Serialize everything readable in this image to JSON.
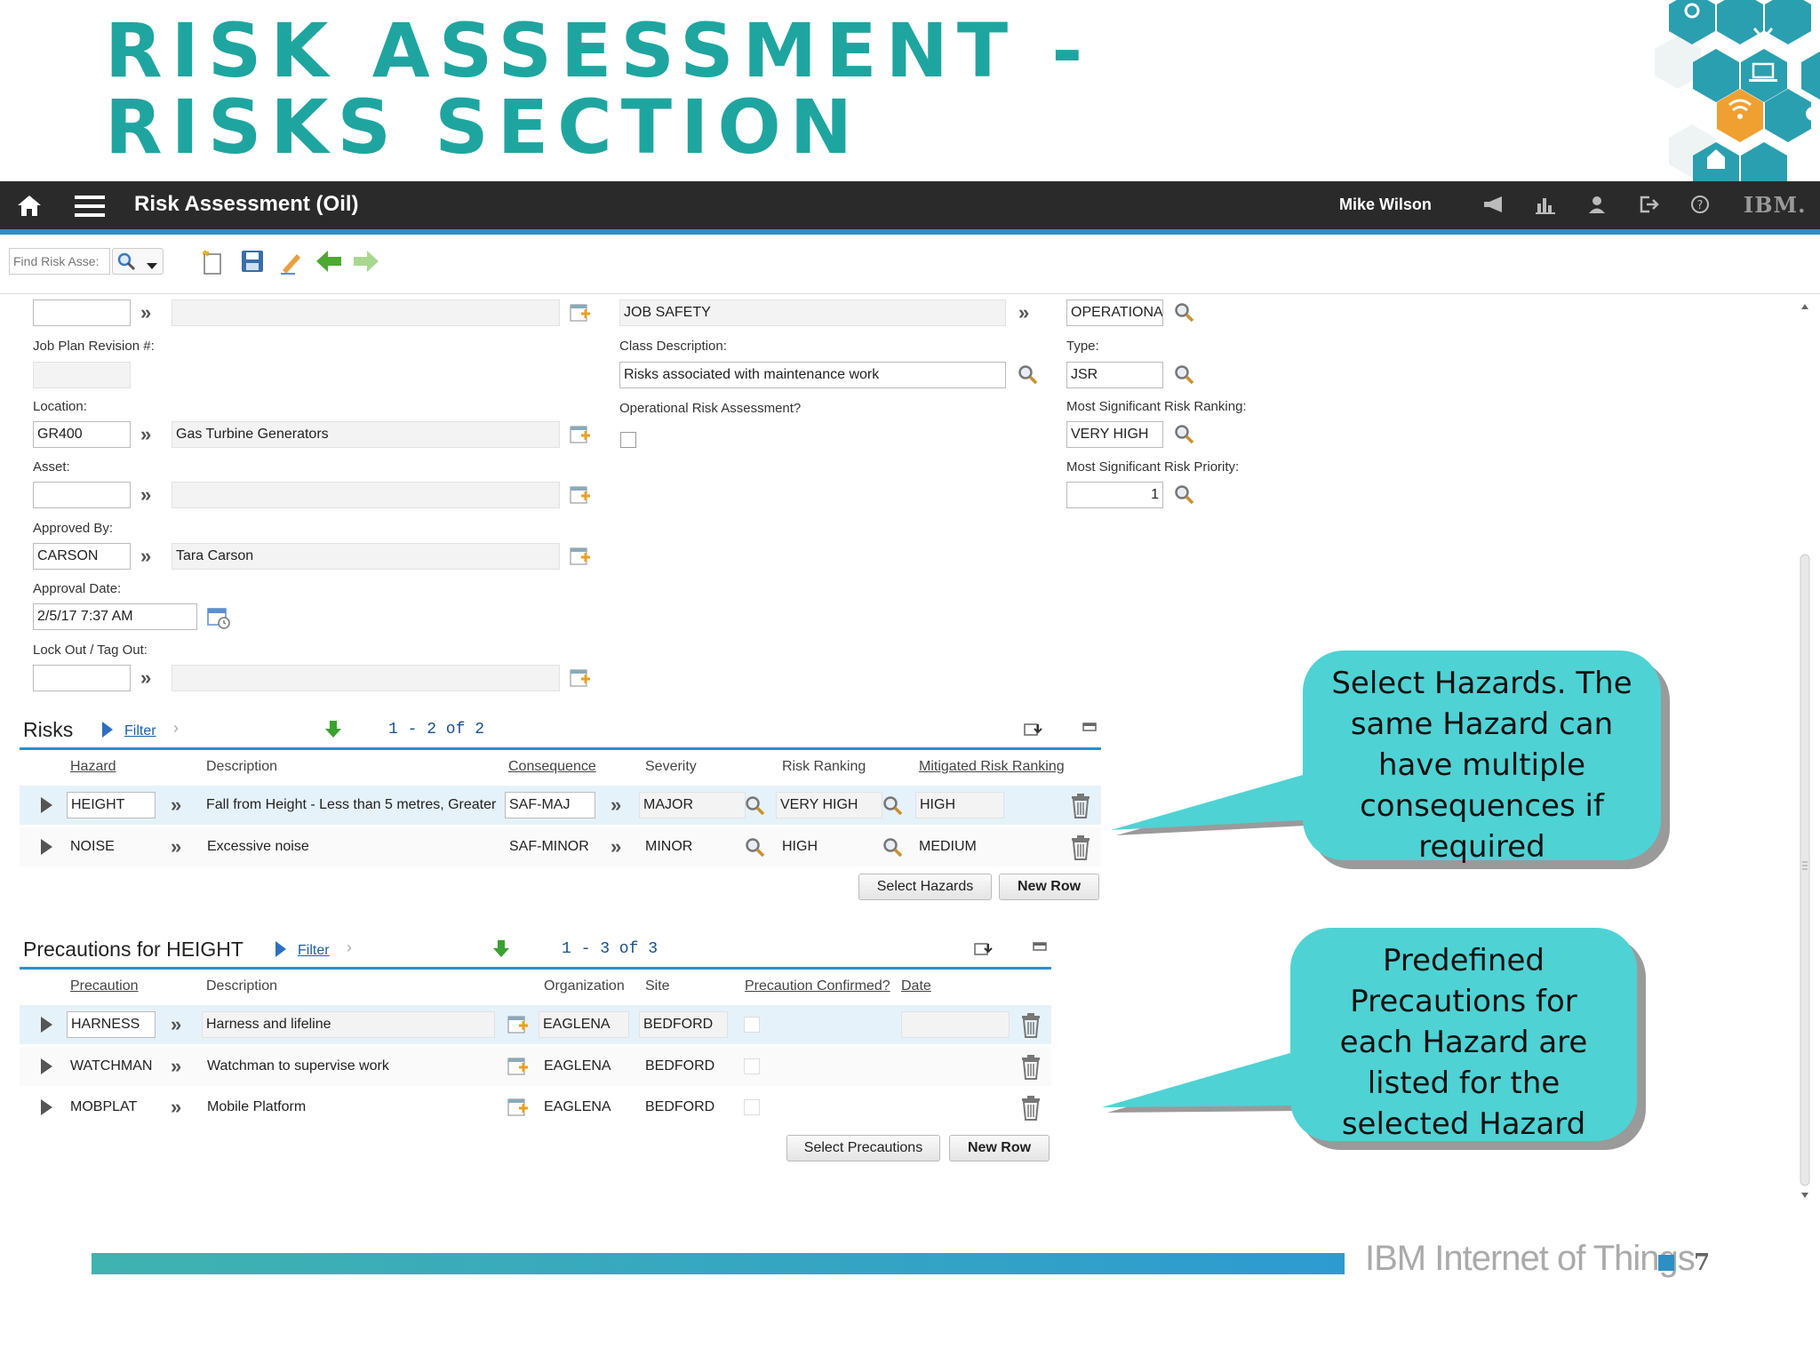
{
  "slide": {
    "title_line1": "Risk assessment -",
    "title_line2": "Risks section",
    "footer_brand": "IBM Internet of Things",
    "page_number": "7"
  },
  "appbar": {
    "title": "Risk Assessment (Oil)",
    "user": "Mike Wilson",
    "ibm": "IBM."
  },
  "toolbar": {
    "find_placeholder": "Find Risk Asse:"
  },
  "form": {
    "class_value": "JOB SAFETY",
    "category_value": "OPERATIONAL",
    "job_plan_revision_label": "Job Plan Revision #:",
    "class_description_label": "Class Description:",
    "class_description_value": "Risks associated with maintenance work",
    "type_label": "Type:",
    "type_value": "JSR",
    "location_label": "Location:",
    "location_value": "GR400",
    "location_desc": "Gas Turbine Generators",
    "operational_label": "Operational Risk Assessment?",
    "ranking_label": "Most Significant Risk Ranking:",
    "ranking_value": "VERY HIGH",
    "asset_label": "Asset:",
    "priority_label": "Most Significant Risk Priority:",
    "priority_value": "1",
    "approved_by_label": "Approved By:",
    "approved_by_value": "CARSON",
    "approved_by_name": "Tara Carson",
    "approval_date_label": "Approval Date:",
    "approval_date_value": "2/5/17 7:37 AM",
    "lockout_label": "Lock Out / Tag Out:"
  },
  "risks": {
    "title": "Risks",
    "filter": "Filter",
    "pager": "1 - 2 of 2",
    "headers": {
      "hazard": "Hazard",
      "description": "Description",
      "consequence": "Consequence",
      "severity": "Severity",
      "risk_ranking": "Risk Ranking",
      "mitigated": "Mitigated Risk Ranking"
    },
    "rows": [
      {
        "hazard": "HEIGHT",
        "description": "Fall from Height - Less than 5 metres, Greater",
        "consequence": "SAF-MAJ",
        "severity": "MAJOR",
        "ranking": "VERY HIGH",
        "mitigated": "HIGH"
      },
      {
        "hazard": "NOISE",
        "description": "Excessive noise",
        "consequence": "SAF-MINOR",
        "severity": "MINOR",
        "ranking": "HIGH",
        "mitigated": "MEDIUM"
      }
    ],
    "select_button": "Select Hazards",
    "new_row_button": "New Row"
  },
  "precautions": {
    "title": "Precautions for HEIGHT",
    "filter": "Filter",
    "pager": "1 - 3 of 3",
    "headers": {
      "precaution": "Precaution",
      "description": "Description",
      "organization": "Organization",
      "site": "Site",
      "confirmed": "Precaution Confirmed?",
      "date": "Date"
    },
    "rows": [
      {
        "precaution": "HARNESS",
        "description": "Harness and lifeline",
        "organization": "EAGLENA",
        "site": "BEDFORD"
      },
      {
        "precaution": "WATCHMAN",
        "description": "Watchman to supervise work",
        "organization": "EAGLENA",
        "site": "BEDFORD"
      },
      {
        "precaution": "MOBPLAT",
        "description": "Mobile Platform",
        "organization": "EAGLENA",
        "site": "BEDFORD"
      }
    ],
    "select_button": "Select Precautions",
    "new_row_button": "New Row"
  },
  "callouts": {
    "hazards": [
      "Select Hazards. The",
      "same Hazard can",
      "have multiple",
      "consequences if",
      "required"
    ],
    "precautions": [
      "Predefined",
      "Precautions for",
      "each Hazard are",
      "listed for the",
      "selected Hazard"
    ]
  },
  "colors": {
    "title_teal": "#1fa5a0",
    "appbar_bg": "#2a2a2a",
    "accent_blue": "#2d8fc4",
    "callout_cyan": "#4fd2d4",
    "hex_teal": "#2a9fb0",
    "hex_orange": "#f0a030"
  },
  "icons": [
    "home-icon",
    "hamburger-menu-icon",
    "megaphone-icon",
    "chart-icon",
    "user-icon",
    "logout-icon",
    "help-icon",
    "search-icon",
    "new-record-icon",
    "save-icon",
    "edit-icon",
    "back-arrow-icon",
    "forward-arrow-icon",
    "detail-menu-icon",
    "calendar-icon",
    "trash-icon",
    "download-icon",
    "collapse-icon",
    "wifi-icon",
    "laptop-icon",
    "gear-icon",
    "cloud-icon"
  ]
}
